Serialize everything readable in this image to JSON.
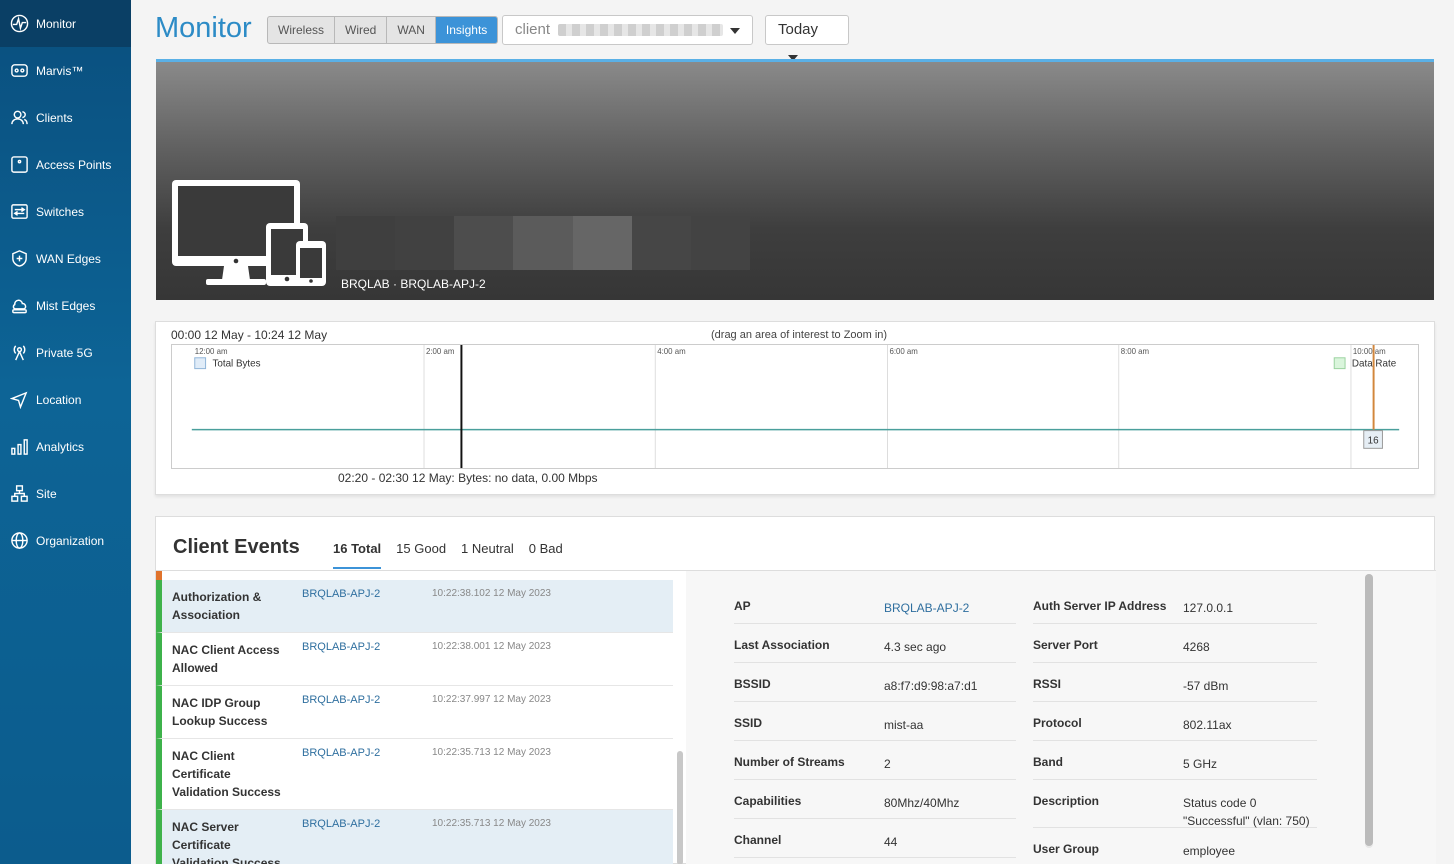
{
  "sidebar": {
    "items": [
      {
        "label": "Monitor",
        "icon": "monitor-pulse-icon"
      },
      {
        "label": "Marvis™",
        "icon": "marvis-icon"
      },
      {
        "label": "Clients",
        "icon": "users-icon"
      },
      {
        "label": "Access Points",
        "icon": "access-point-icon"
      },
      {
        "label": "Switches",
        "icon": "switch-icon"
      },
      {
        "label": "WAN Edges",
        "icon": "shield-plus-icon"
      },
      {
        "label": "Mist Edges",
        "icon": "cloud-stack-icon"
      },
      {
        "label": "Private 5G",
        "icon": "antenna-icon"
      },
      {
        "label": "Location",
        "icon": "location-arrow-icon"
      },
      {
        "label": "Analytics",
        "icon": "bar-chart-icon"
      },
      {
        "label": "Site",
        "icon": "site-tree-icon"
      },
      {
        "label": "Organization",
        "icon": "globe-icon"
      }
    ]
  },
  "header": {
    "title": "Monitor",
    "tabs": [
      "Wireless",
      "Wired",
      "WAN",
      "Insights"
    ],
    "active_tab": "Insights",
    "client_select": "client",
    "period_select": "Today"
  },
  "banner": {
    "subtitle": "BRQLAB · BRQLAB-APJ-2"
  },
  "timeline": {
    "range": "00:00 12 May - 10:24 12 May",
    "hint": "(drag an area of interest to Zoom in)",
    "hover_info": "02:20 - 02:30 12 May: Bytes: no data, 0.00 Mbps",
    "ticks": [
      "12:00 am",
      "2:00 am",
      "4:00 am",
      "6:00 am",
      "8:00 am",
      "10:00 am"
    ],
    "legend_left": "Total Bytes",
    "legend_right": "Data Rate",
    "event_count": "16"
  },
  "events": {
    "title": "Client Events",
    "tabs": [
      "16 Total",
      "15 Good",
      "1 Neutral",
      "0 Bad"
    ],
    "rows": [
      {
        "name": "Authorization & Association",
        "ap": "BRQLAB-APJ-2",
        "time": "10:22:38.102 12 May 2023"
      },
      {
        "name": "NAC Client Access Allowed",
        "ap": "BRQLAB-APJ-2",
        "time": "10:22:38.001 12 May 2023"
      },
      {
        "name": "NAC IDP Group Lookup Success",
        "ap": "BRQLAB-APJ-2",
        "time": "10:22:37.997 12 May 2023"
      },
      {
        "name": "NAC Client Certificate Validation Success",
        "ap": "BRQLAB-APJ-2",
        "time": "10:22:35.713 12 May 2023"
      },
      {
        "name": "NAC Server Certificate Validation Success",
        "ap": "BRQLAB-APJ-2",
        "time": "10:22:35.713 12 May 2023"
      }
    ]
  },
  "details": {
    "left": [
      {
        "key": "AP",
        "value": "BRQLAB-APJ-2"
      },
      {
        "key": "Last Association",
        "value": "4.3 sec ago"
      },
      {
        "key": "BSSID",
        "value": "a8:f7:d9:98:a7:d1"
      },
      {
        "key": "SSID",
        "value": "mist-aa"
      },
      {
        "key": "Number of Streams",
        "value": "2"
      },
      {
        "key": "Capabilities",
        "value": "80Mhz/40Mhz"
      },
      {
        "key": "Channel",
        "value": "44"
      }
    ],
    "right": [
      {
        "key": "Auth Server IP Address",
        "value": "127.0.0.1"
      },
      {
        "key": "Server Port",
        "value": "4268"
      },
      {
        "key": "RSSI",
        "value": "-57 dBm"
      },
      {
        "key": "Protocol",
        "value": "802.11ax"
      },
      {
        "key": "Band",
        "value": "5 GHz"
      },
      {
        "key": "Description",
        "value": "Status code 0 \"Successful\" (vlan: 750)"
      },
      {
        "key": "User Group",
        "value": "employee"
      }
    ]
  },
  "colors": {
    "sidebar": "#0d6496",
    "accent": "#3c93d8",
    "good": "#3eb24b",
    "neutral": "#e0732c",
    "link": "#2f6f9f"
  }
}
